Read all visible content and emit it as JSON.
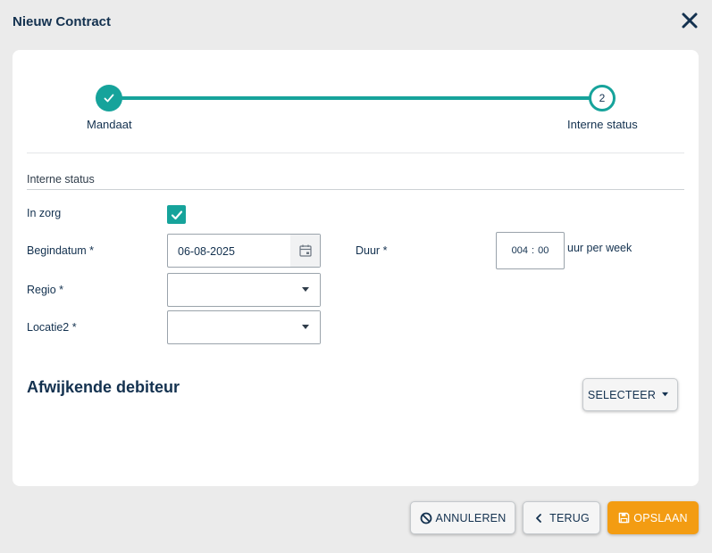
{
  "dialog": {
    "title": "Nieuw Contract"
  },
  "stepper": {
    "steps": [
      {
        "label": "Mandaat",
        "state": "completed"
      },
      {
        "label": "Interne status",
        "number": "2",
        "state": "active"
      }
    ]
  },
  "form": {
    "section_title": "Interne status",
    "in_zorg": {
      "label": "In zorg",
      "checked": true
    },
    "begindatum": {
      "label": "Begindatum *",
      "value": "06-08-2025"
    },
    "duur": {
      "label": "Duur *",
      "hours": "004",
      "separator": ":",
      "minutes": "00",
      "suffix": "uur per week"
    },
    "regio": {
      "label": "Regio *",
      "value": ""
    },
    "locatie2": {
      "label": "Locatie2 *",
      "value": ""
    }
  },
  "debiteur": {
    "title": "Afwijkende debiteur",
    "select_label": "SELECTEER"
  },
  "footer": {
    "cancel_label": "ANNULEREN",
    "back_label": "TERUG",
    "save_label": "OPSLAAN"
  },
  "colors": {
    "accent": "#16a39b",
    "primary": "#f39c12",
    "text": "#13314f"
  }
}
